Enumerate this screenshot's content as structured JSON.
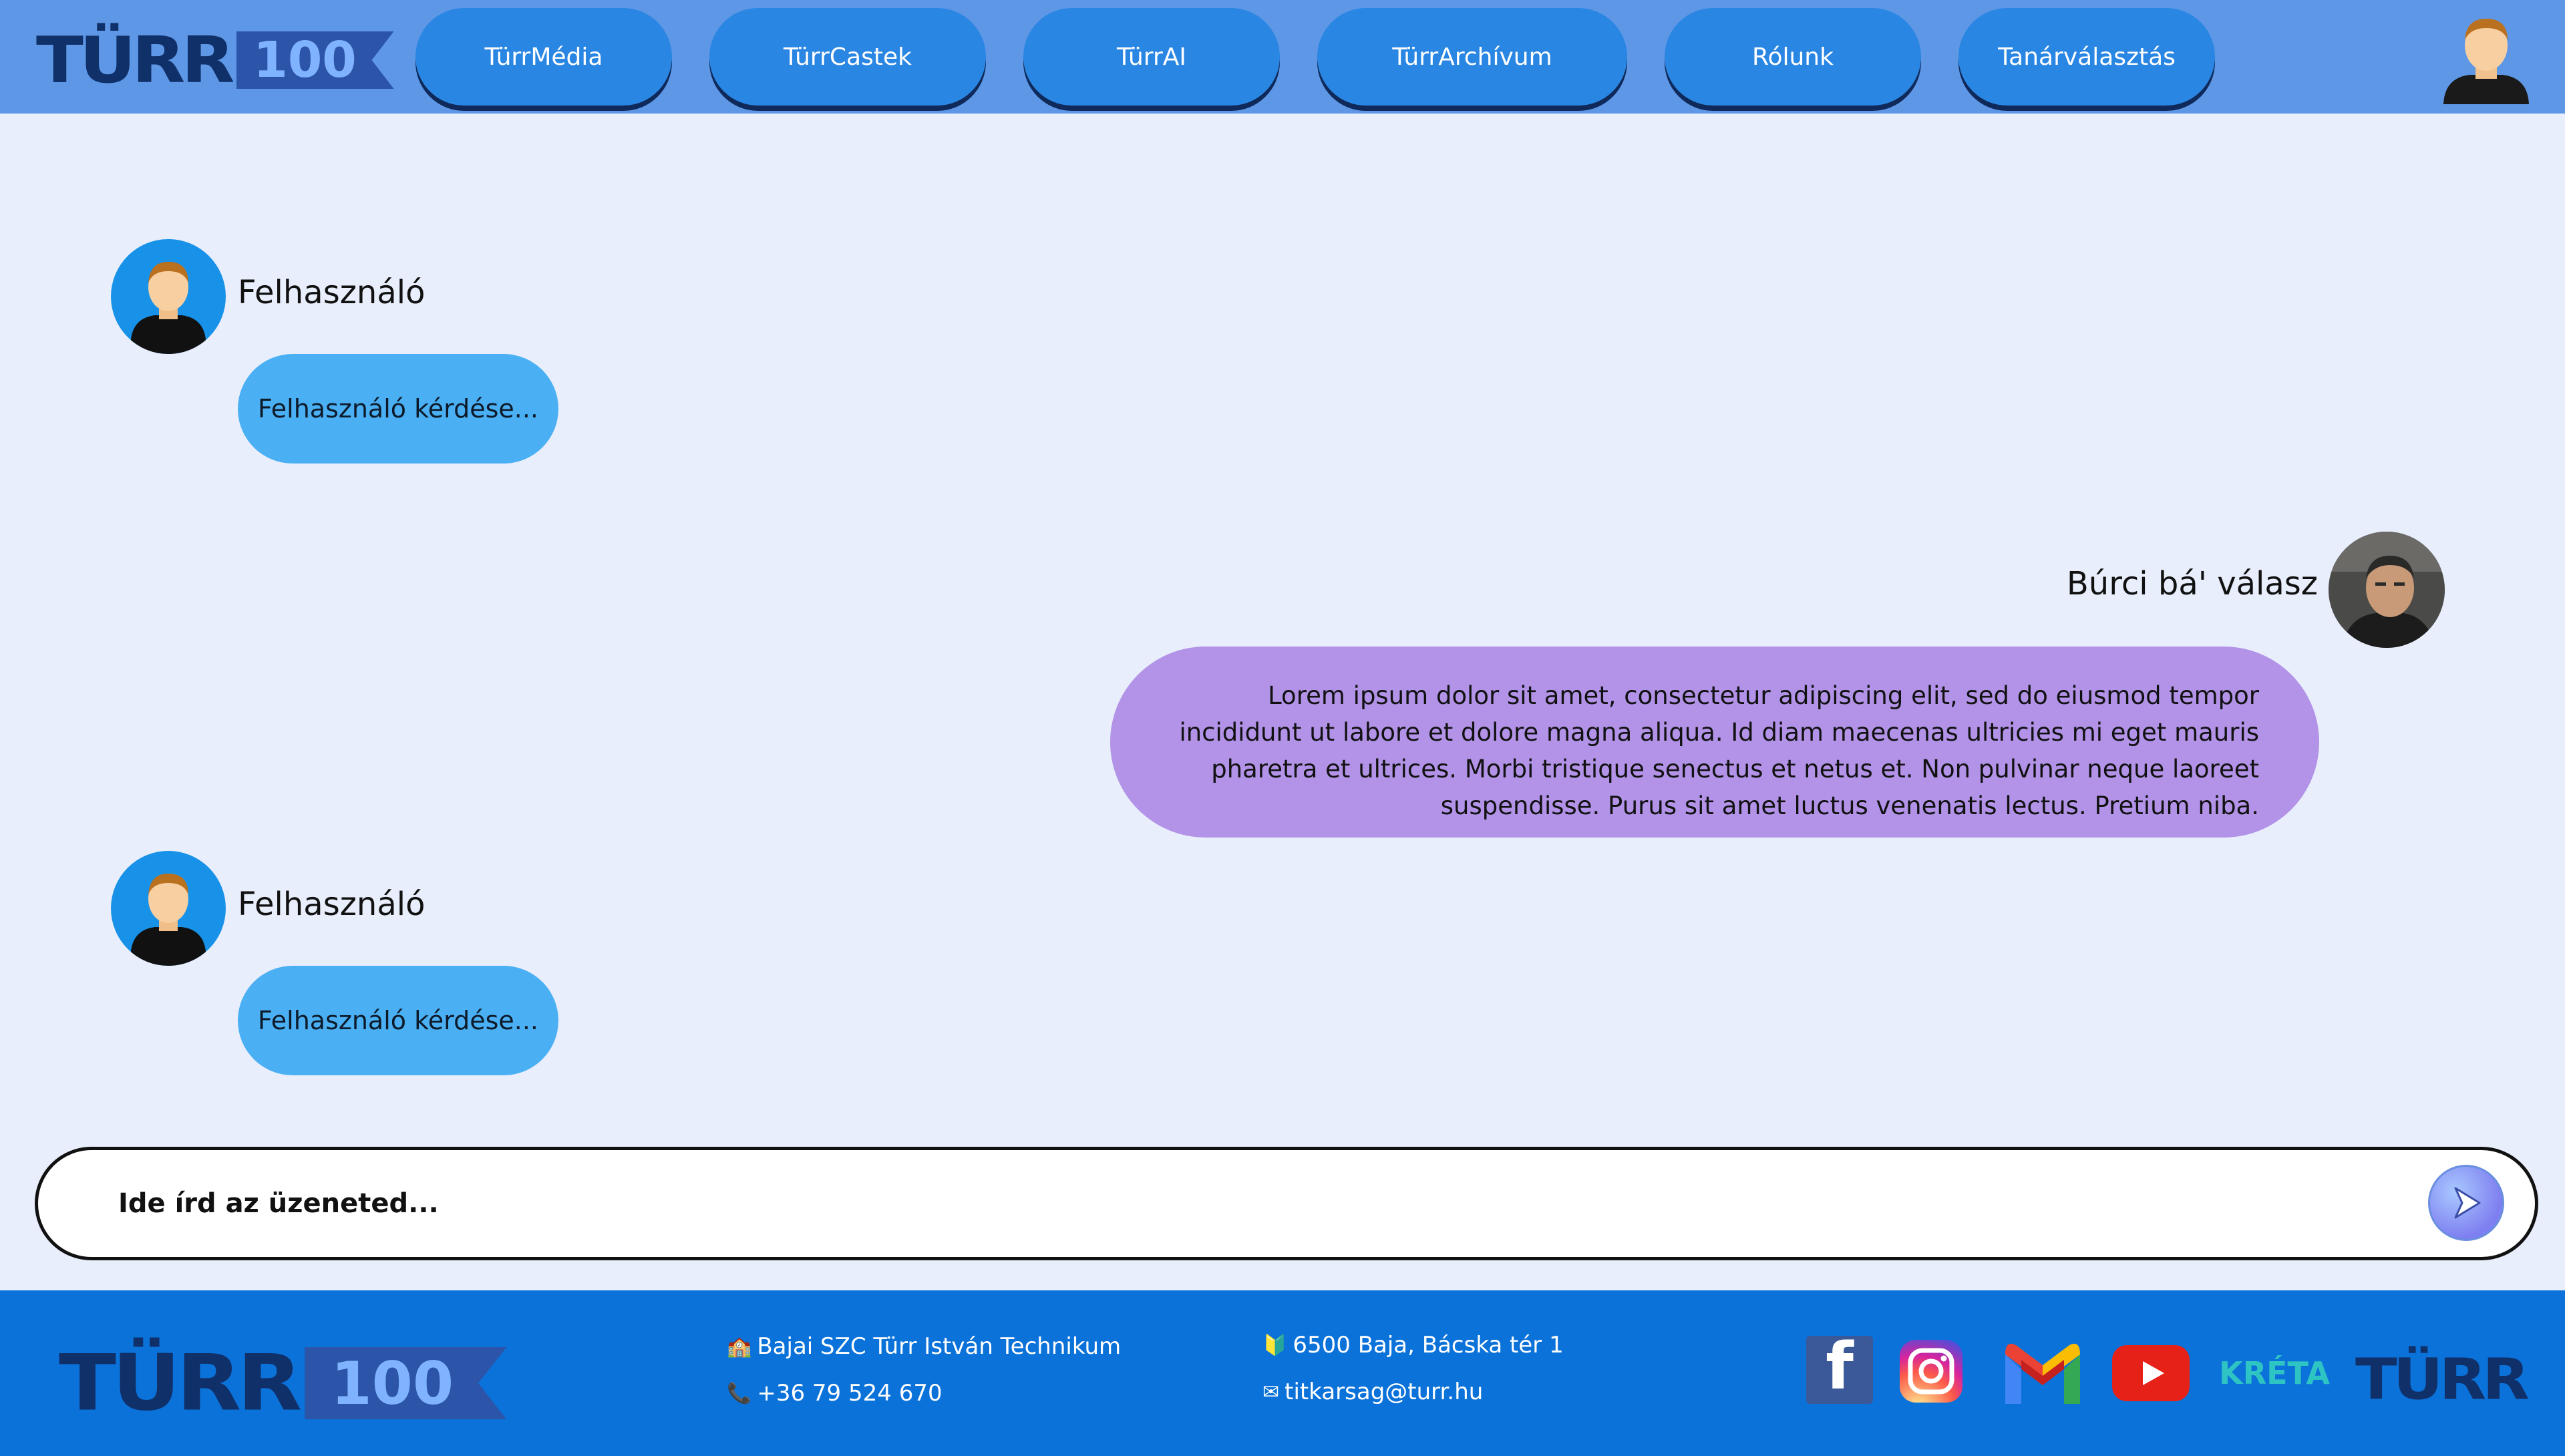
{
  "brand": {
    "logo_text": "TÜRR",
    "badge_text": "100"
  },
  "nav": {
    "items": [
      {
        "label": "TürrMédia"
      },
      {
        "label": "TürrCastek"
      },
      {
        "label": "TürrAI"
      },
      {
        "label": "TürrArchívum"
      },
      {
        "label": "Rólunk"
      },
      {
        "label": "Tanárválasztás"
      }
    ]
  },
  "chat": {
    "messages": [
      {
        "sender": "Felhasználó",
        "text": "Felhasználó kérdése..."
      },
      {
        "sender": "Búrci bá' válasz",
        "text": "Lorem ipsum dolor sit amet, consectetur adipiscing elit, sed do eiusmod tempor incididunt ut labore et dolore magna aliqua. Id diam maecenas ultricies mi eget mauris pharetra et ultrices. Morbi tristique senectus et netus et. Non pulvinar neque laoreet suspendisse. Purus sit amet luctus venenatis lectus. Pretium niba."
      },
      {
        "sender": "Felhasználó",
        "text": "Felhasználó kérdése..."
      }
    ]
  },
  "input": {
    "placeholder": "Ide írd az üzeneted..."
  },
  "footer": {
    "school": "Bajai SZC Türr István Technikum",
    "phone": "+36 79 524 670",
    "address": "6500 Baja, Bácska tér 1",
    "email": "titkarsag@turr.hu",
    "kreta_label": "KRÉTA"
  },
  "icons": {
    "header_profile": "user-avatar-icon",
    "send": "send-arrow-icon",
    "school": "school-building-icon",
    "phone": "phone-icon",
    "address": "location-pin-icon",
    "email": "envelope-icon",
    "social": [
      "facebook-icon",
      "instagram-icon",
      "gmail-icon",
      "youtube-icon",
      "kreta-icon",
      "turr-logo-icon"
    ]
  },
  "colors": {
    "header_bg": "#5e97e6",
    "nav_button": "#2a86e3",
    "page_bg": "#e9eefc",
    "user_bubble": "#4ab0f3",
    "bot_bubble": "#b293e8",
    "footer_bg": "#0b72d9"
  }
}
